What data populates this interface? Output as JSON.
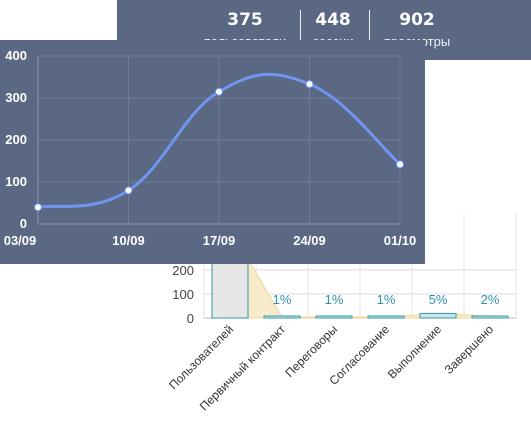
{
  "stats": [
    {
      "value": "375",
      "label": "пользователи"
    },
    {
      "value": "448",
      "label": "сессии"
    },
    {
      "value": "902",
      "label": "просмотры"
    }
  ],
  "colors": {
    "panel": "#5a6883",
    "line": "#6f95f0",
    "bars_teal": "#2f9aa8",
    "area": "#f3d79a"
  },
  "chart_data": [
    {
      "type": "line",
      "categories": [
        "03/09",
        "10/09",
        "17/09",
        "24/09",
        "01/10"
      ],
      "values": [
        40,
        80,
        315,
        333,
        142
      ],
      "ylim": [
        0,
        400
      ],
      "yticks": [
        "0",
        "100",
        "200",
        "300",
        "400"
      ],
      "grid": true
    },
    {
      "type": "bar",
      "categories": [
        "Пользователей",
        "Первичный контракт",
        "Переговоры",
        "Согласование",
        "Выполнение",
        "Завершено"
      ],
      "values": [
        375,
        4,
        4,
        4,
        19,
        8
      ],
      "data_labels": [
        "",
        "1%",
        "1%",
        "1%",
        "5%",
        "2%"
      ],
      "yticks": [
        "0",
        "100",
        "200"
      ],
      "ylim": [
        0,
        400
      ],
      "grid": true
    }
  ]
}
